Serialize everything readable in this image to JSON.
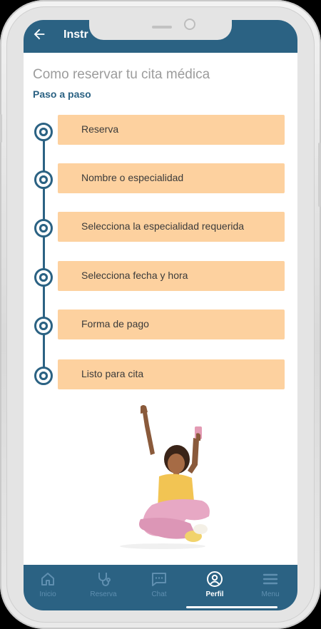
{
  "appbar": {
    "title": "Instr",
    "back_icon": "arrow-left-icon"
  },
  "page": {
    "title": "Como reservar tu cita médica",
    "subtitle": "Paso a paso"
  },
  "steps": [
    {
      "label": "Reserva"
    },
    {
      "label": "Nombre o especialidad"
    },
    {
      "label": "Selecciona la especialidad requerida"
    },
    {
      "label": "Selecciona fecha y hora"
    },
    {
      "label": "Forma de pago"
    },
    {
      "label": "Listo para cita"
    }
  ],
  "bottom_nav": [
    {
      "label": "Inicio",
      "icon": "home-icon"
    },
    {
      "label": "Reserva",
      "icon": "stethoscope-icon"
    },
    {
      "label": "Chat",
      "icon": "chat-icon"
    },
    {
      "label": "Perfil",
      "icon": "profile-icon",
      "active": true
    },
    {
      "label": "Menu",
      "icon": "menu-icon"
    }
  ],
  "colors": {
    "primary": "#2b6283",
    "step_card": "#fdd19f",
    "title_gray": "#9c9c9c",
    "nav_inactive": "#5f8fb0"
  }
}
